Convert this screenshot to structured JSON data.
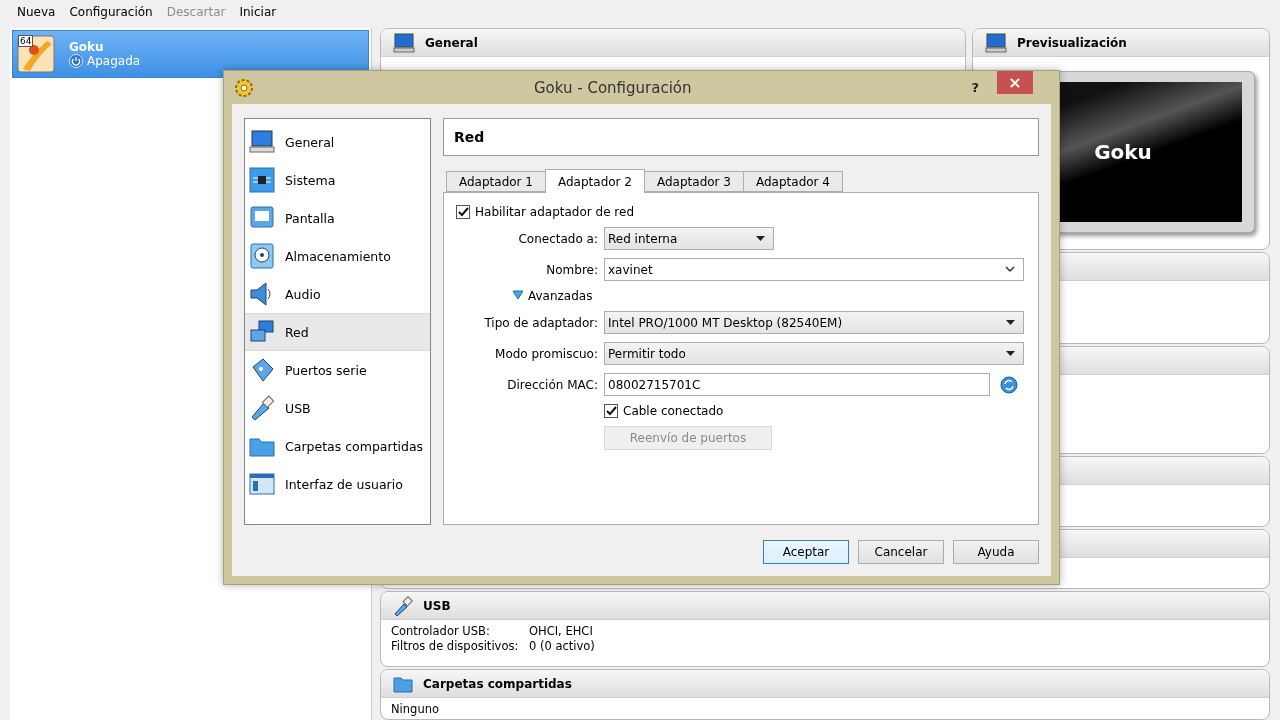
{
  "toolbar": [
    {
      "label": "Nueva",
      "disabled": false
    },
    {
      "label": "Configuración",
      "disabled": false
    },
    {
      "label": "Descartar",
      "disabled": true
    },
    {
      "label": "Iniciar",
      "disabled": false
    }
  ],
  "vm_list": [
    {
      "name": "Goku",
      "state": "Apagada",
      "badge": "64",
      "selected": true
    }
  ],
  "details": {
    "general": {
      "title": "General"
    },
    "preview": {
      "title": "Previsualización",
      "screen_text": "Goku"
    },
    "usb": {
      "title": "USB",
      "rows": [
        {
          "label": "Controlador USB:",
          "value": "OHCI, EHCI"
        },
        {
          "label": "Filtros de dispositivos:",
          "value": "0 (0 activo)"
        }
      ]
    },
    "shared_folders": {
      "title": "Carpetas compartidas",
      "text": "Ninguno"
    }
  },
  "dialog": {
    "title": "Goku - Configuración",
    "help": "?",
    "close": "×",
    "sections": [
      {
        "label": "General",
        "kind": "general",
        "selected": false
      },
      {
        "label": "Sistema",
        "kind": "system",
        "selected": false
      },
      {
        "label": "Pantalla",
        "kind": "display",
        "selected": false
      },
      {
        "label": "Almacenamiento",
        "kind": "storage",
        "selected": false
      },
      {
        "label": "Audio",
        "kind": "audio",
        "selected": false
      },
      {
        "label": "Red",
        "kind": "network",
        "selected": true
      },
      {
        "label": "Puertos serie",
        "kind": "serial",
        "selected": false
      },
      {
        "label": "USB",
        "kind": "usb",
        "selected": false
      },
      {
        "label": "Carpetas compartidas",
        "kind": "folder",
        "selected": false
      },
      {
        "label": "Interfaz de usuario",
        "kind": "ui",
        "selected": false
      }
    ],
    "section_title": "Red",
    "tabs": [
      {
        "label": "Adaptador 1",
        "selected": false
      },
      {
        "label": "Adaptador 2",
        "selected": true
      },
      {
        "label": "Adaptador 3",
        "selected": false
      },
      {
        "label": "Adaptador 4",
        "selected": false
      }
    ],
    "enable_adapter": {
      "label": "Habilitar adaptador de red",
      "checked": true
    },
    "fields": [
      {
        "kind": "select",
        "label": "Conectado a:",
        "value": "Red interna"
      },
      {
        "kind": "combo",
        "label": "Nombre:",
        "value": "xavinet"
      }
    ],
    "advanced": {
      "label": "Avanzadas",
      "expanded": true
    },
    "advanced_fields": [
      {
        "kind": "select",
        "label": "Tipo de adaptador:",
        "value": "Intel PRO/1000 MT Desktop (82540EM)"
      },
      {
        "kind": "select",
        "label": "Modo promiscuo:",
        "value": "Permitir todo"
      },
      {
        "kind": "text",
        "label": "Dirección MAC:",
        "value": "08002715701C"
      }
    ],
    "cable": {
      "label": "Cable conectado",
      "checked": true
    },
    "port_forwarding": {
      "label": "Reenvío de puertos",
      "disabled": true
    },
    "buttons": [
      {
        "label": "Aceptar",
        "kind": "default"
      },
      {
        "label": "Cancelar",
        "kind": "normal"
      },
      {
        "label": "Ayuda",
        "kind": "normal"
      }
    ]
  }
}
